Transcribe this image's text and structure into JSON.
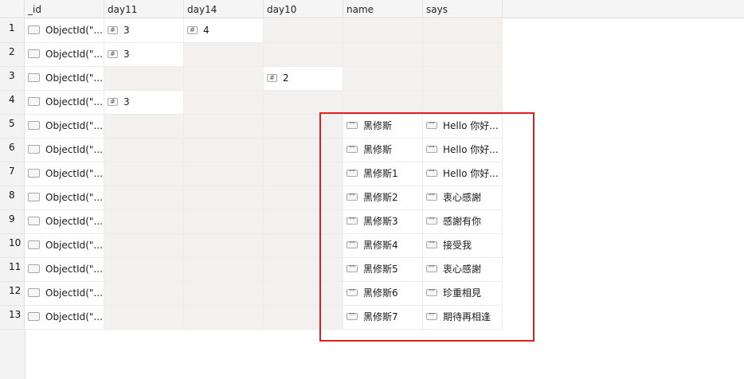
{
  "columns": [
    "_id",
    "day11",
    "day14",
    "day10",
    "name",
    "says"
  ],
  "icons": {
    "object": "document-icon",
    "number": "number-icon",
    "string": "string-quote-icon",
    "number_glyph": "#",
    "string_glyph": "\"\""
  },
  "rows": [
    {
      "num": "1",
      "id": "ObjectId(\"...",
      "day11": "3",
      "day14": "4",
      "day10": "",
      "name": "",
      "says": ""
    },
    {
      "num": "2",
      "id": "ObjectId(\"...",
      "day11": "3",
      "day14": "",
      "day10": "",
      "name": "",
      "says": ""
    },
    {
      "num": "3",
      "id": "ObjectId(\"...",
      "day11": "",
      "day14": "",
      "day10": "2",
      "name": "",
      "says": ""
    },
    {
      "num": "4",
      "id": "ObjectId(\"...",
      "day11": "3",
      "day14": "",
      "day10": "",
      "name": "",
      "says": ""
    },
    {
      "num": "5",
      "id": "ObjectId(\"...",
      "day11": "",
      "day14": "",
      "day10": "",
      "name": "黑修斯",
      "says": "Hello 你好..."
    },
    {
      "num": "6",
      "id": "ObjectId(\"...",
      "day11": "",
      "day14": "",
      "day10": "",
      "name": "黑修斯",
      "says": "Hello 你好..."
    },
    {
      "num": "7",
      "id": "ObjectId(\"...",
      "day11": "",
      "day14": "",
      "day10": "",
      "name": "黑修斯1",
      "says": "Hello 你好..."
    },
    {
      "num": "8",
      "id": "ObjectId(\"...",
      "day11": "",
      "day14": "",
      "day10": "",
      "name": "黑修斯2",
      "says": "衷心感謝"
    },
    {
      "num": "9",
      "id": "ObjectId(\"...",
      "day11": "",
      "day14": "",
      "day10": "",
      "name": "黑修斯3",
      "says": "感謝有你"
    },
    {
      "num": "10",
      "id": "ObjectId(\"...",
      "day11": "",
      "day14": "",
      "day10": "",
      "name": "黑修斯4",
      "says": "接受我"
    },
    {
      "num": "11",
      "id": "ObjectId(\"...",
      "day11": "",
      "day14": "",
      "day10": "",
      "name": "黑修斯5",
      "says": "衷心感謝"
    },
    {
      "num": "12",
      "id": "ObjectId(\"...",
      "day11": "",
      "day14": "",
      "day10": "",
      "name": "黑修斯6",
      "says": "珍重相見"
    },
    {
      "num": "13",
      "id": "ObjectId(\"...",
      "day11": "",
      "day14": "",
      "day10": "",
      "name": "黑修斯7",
      "says": "期待再相逢"
    }
  ],
  "highlight_color": "#e02020"
}
